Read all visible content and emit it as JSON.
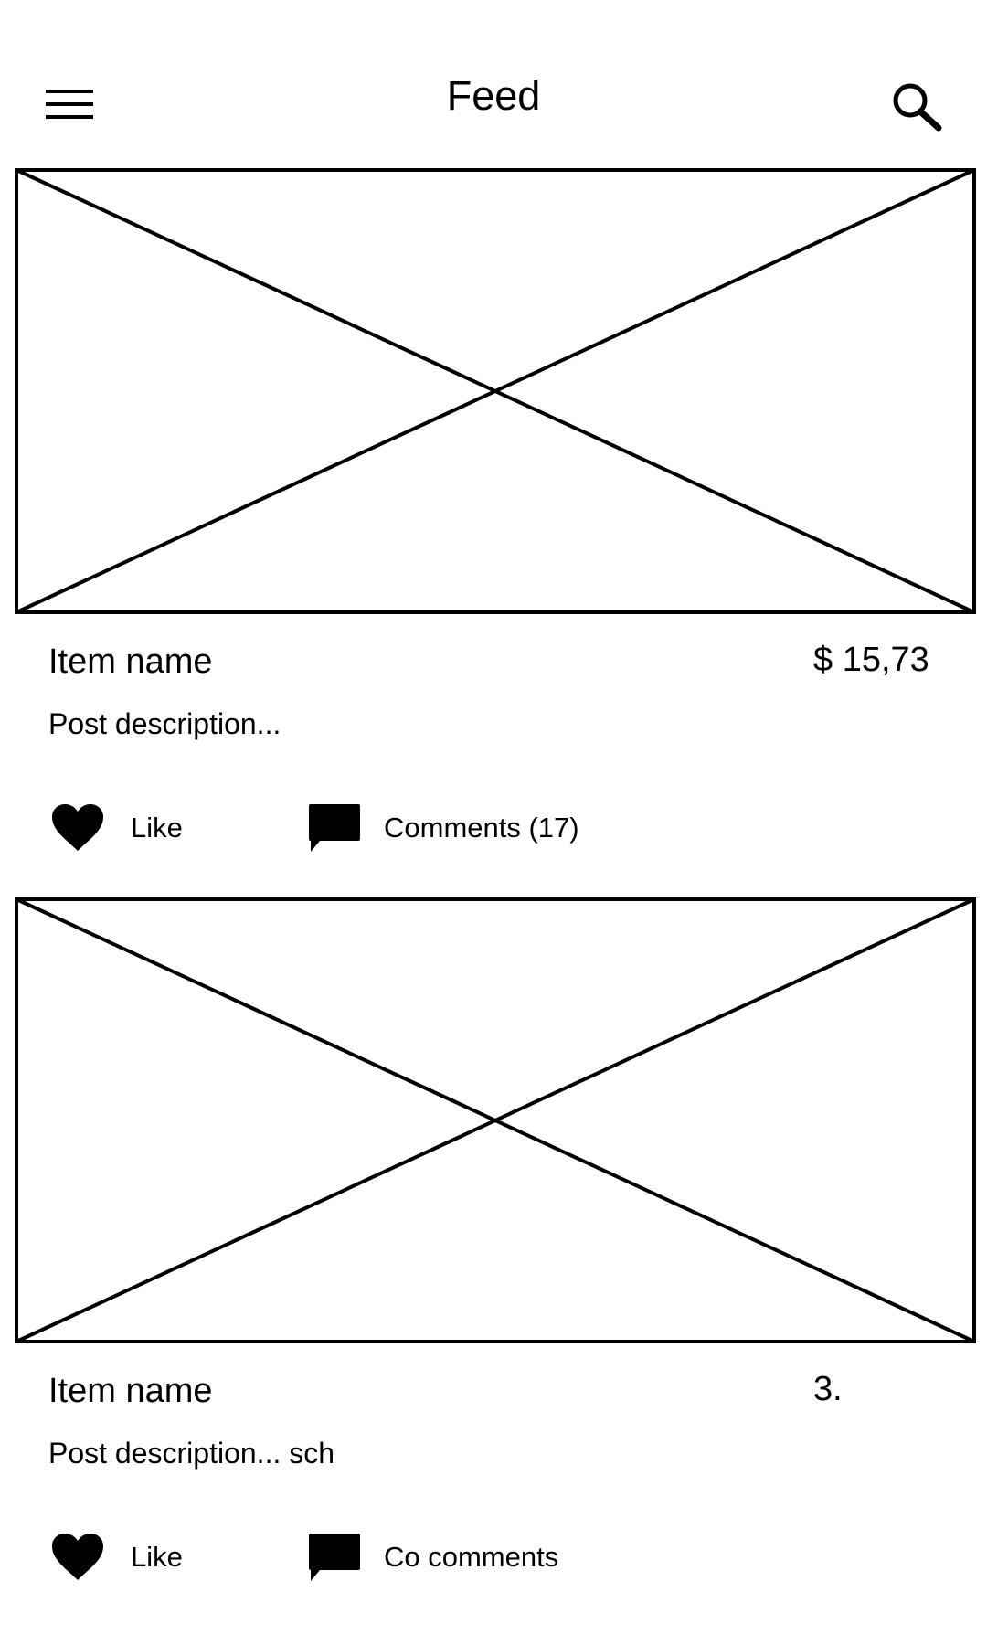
{
  "header": {
    "title": "Feed",
    "menu_icon": "hamburger-menu-icon",
    "search_icon": "search-icon"
  },
  "posts": [
    {
      "image_icon": "image-placeholder",
      "item_name": "Item name",
      "price": "$ 15,73",
      "description": "Post description...",
      "like_label": "Like",
      "comments_label": "Comments (17)"
    },
    {
      "image_icon": "image-placeholder",
      "item_name": "Item name",
      "price": "3.",
      "description": "Post description... sch",
      "like_label": "Like",
      "comments_label": "Co comments"
    }
  ],
  "colors": {
    "stroke": "#000000",
    "background": "#ffffff"
  }
}
